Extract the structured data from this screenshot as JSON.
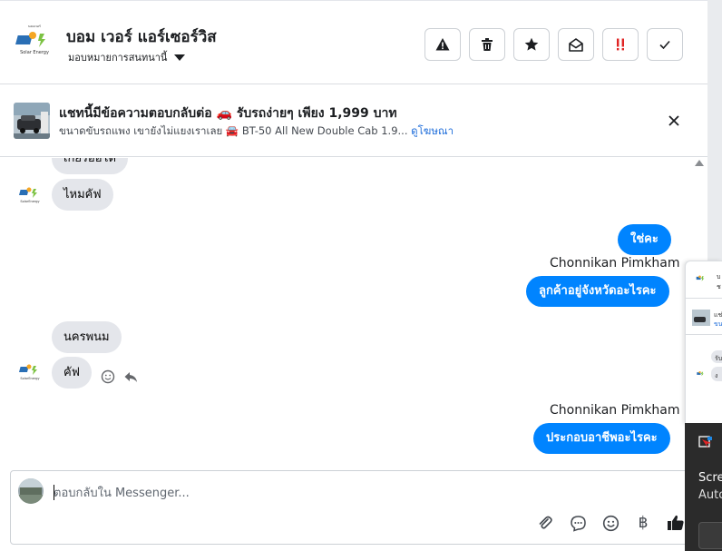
{
  "header": {
    "page_name": "บอม เวอร์ แอร์เซอร์วิส",
    "assign_label": "มอบหมายการสนทนานี้",
    "actions": [
      "report-icon",
      "trash-icon",
      "star-icon",
      "mark-unread-icon",
      "spam-icon",
      "done-icon"
    ]
  },
  "ad": {
    "title": "แชทนี้มีข้อความตอบกลับต่อ 🚗 รับรถง่ายๆ เพียง 1,999 บาท",
    "subtitle": "ขนาดขับรถแพง เขายังไม่แยงเราเลย 🚘 BT-50 All New Double Cab 1.9...",
    "link": "ดูโฆษณา"
  },
  "messages": {
    "m0": "เกียร์ออโต้",
    "m1": "ไหมคัฟ",
    "m2": "ใช่คะ",
    "sender1": "Chonnikan Pimkham",
    "m3": "ลูกค้าอยู่จังหวัดอะไรคะ",
    "m4": "นครพนม",
    "m5": "คัฟ",
    "sender2": "Chonnikan Pimkham",
    "m6": "ประกอบอาชีพอะไรคะ"
  },
  "composer": {
    "placeholder": "ตอบกลับใน Messenger...",
    "tools": [
      "attachment-icon",
      "saved-reply-icon",
      "emoji-icon",
      "payment-icon",
      "like-icon"
    ],
    "currency_symbol": "฿"
  },
  "overlay": {
    "card_snippets": [
      "บ",
      "ช",
      "แช่",
      "ขน",
      "รับ",
      "ง"
    ],
    "dark_text1": "Scre",
    "dark_text2": "Auto"
  }
}
